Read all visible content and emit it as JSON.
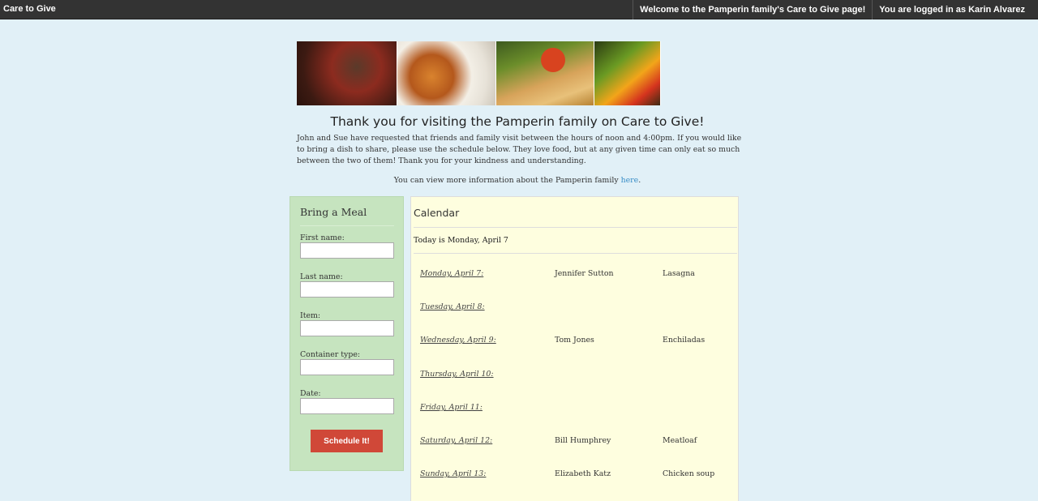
{
  "topbar": {
    "brand": "Care to Give",
    "welcome": "Welcome to the Pamperin family's Care to Give page!",
    "login_status": "You are logged in as Karin Alvarez"
  },
  "page": {
    "heading": "Thank you for visiting the Pamperin family on Care to Give!",
    "intro": "John and Sue have requested that friends and family visit between the hours of noon and 4:00pm. If you would like to bring a dish to share, please use the schedule below. They love food, but at any given time can only eat so much between the two of them! Thank you for your kindness and understanding.",
    "more_info_prefix": "You can view more information about the Pamperin family ",
    "more_info_link": "here",
    "more_info_suffix": "."
  },
  "form": {
    "title": "Bring a Meal",
    "fields": [
      {
        "label": "First name:",
        "value": ""
      },
      {
        "label": "Last name:",
        "value": ""
      },
      {
        "label": "Item:",
        "value": ""
      },
      {
        "label": "Container type:",
        "value": ""
      },
      {
        "label": "Date:",
        "value": ""
      }
    ],
    "submit_label": "Schedule It!"
  },
  "calendar": {
    "title": "Calendar",
    "today": "Today is Monday, April 7",
    "days": [
      {
        "date": "Monday, April 7:",
        "person": "Jennifer Sutton",
        "item": "Lasagna"
      },
      {
        "date": "Tuesday, April 8:",
        "person": "",
        "item": ""
      },
      {
        "date": "Wednesday, April 9:",
        "person": "Tom Jones",
        "item": "Enchiladas"
      },
      {
        "date": "Thursday, April 10:",
        "person": "",
        "item": ""
      },
      {
        "date": "Friday, April 11:",
        "person": "",
        "item": ""
      },
      {
        "date": "Saturday, April 12:",
        "person": "Bill Humphrey",
        "item": "Meatloaf"
      },
      {
        "date": "Sunday, April 13:",
        "person": "Elizabeth Katz",
        "item": "Chicken soup"
      }
    ]
  },
  "colors": {
    "background": "#e1f0f7",
    "topbar": "#333333",
    "form_panel": "#c6e4bf",
    "calendar_panel": "#fefedf",
    "button": "#d04838",
    "link": "#3a8ec7"
  },
  "banner_images": [
    "spice-pot-image",
    "curry-plate-image",
    "vegetables-bread-image",
    "peppers-image"
  ]
}
